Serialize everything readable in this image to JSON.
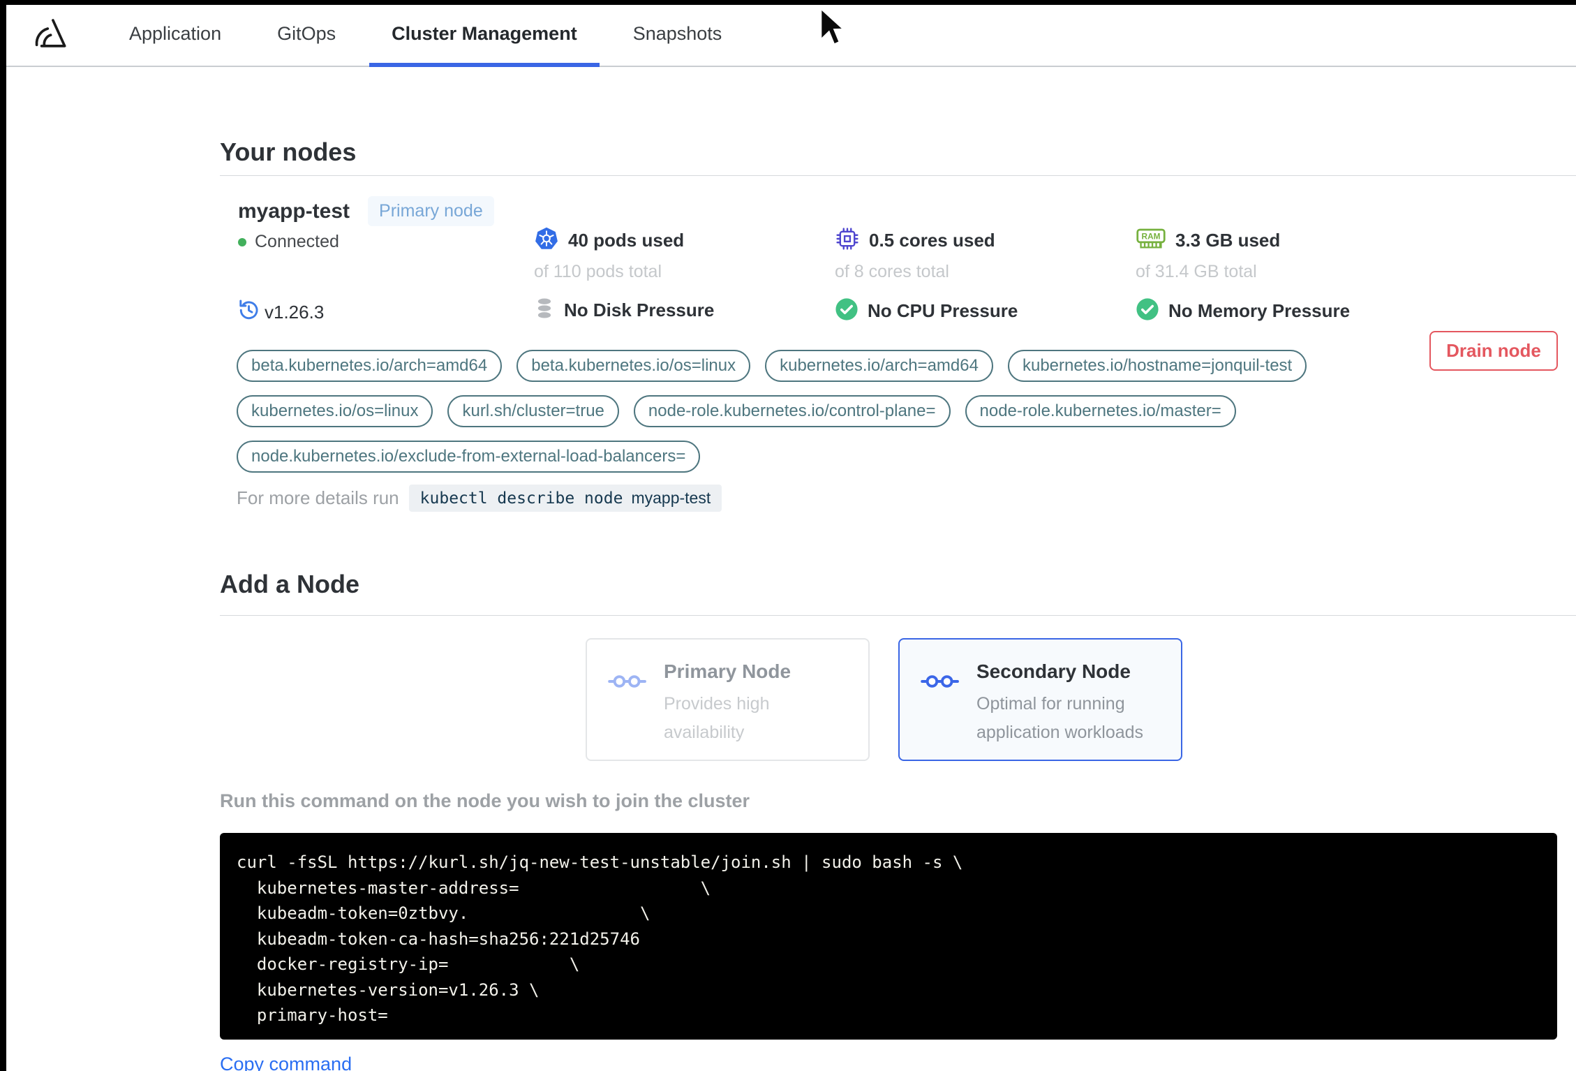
{
  "nav": {
    "tabs": [
      {
        "label": "Application",
        "active": false
      },
      {
        "label": "GitOps",
        "active": false
      },
      {
        "label": "Cluster Management",
        "active": true
      },
      {
        "label": "Snapshots",
        "active": false
      }
    ]
  },
  "your_nodes": {
    "title": "Your nodes",
    "node": {
      "name": "myapp-test",
      "badge": "Primary node",
      "status": "Connected",
      "version": "v1.26.3",
      "stats": [
        {
          "icon": "kubernetes-icon",
          "used": "40 pods used",
          "total": "of 110 pods total"
        },
        {
          "icon": "cpu-icon",
          "used": "0.5 cores used",
          "total": "of 8 cores total"
        },
        {
          "icon": "ram-icon",
          "used": "3.3 GB used",
          "total": "of 31.4 GB total"
        }
      ],
      "conditions": [
        {
          "icon": "disk-icon",
          "label": "No Disk Pressure"
        },
        {
          "icon": "check-circle-icon",
          "label": "No CPU Pressure"
        },
        {
          "icon": "check-circle-icon",
          "label": "No Memory Pressure"
        }
      ],
      "labels": [
        "beta.kubernetes.io/arch=amd64",
        "beta.kubernetes.io/os=linux",
        "kubernetes.io/arch=amd64",
        "kubernetes.io/hostname=jonquil-test",
        "kubernetes.io/os=linux",
        "kurl.sh/cluster=true",
        "node-role.kubernetes.io/control-plane=",
        "node-role.kubernetes.io/master=",
        "node.kubernetes.io/exclude-from-external-load-balancers="
      ],
      "details": {
        "prefix": "For more details run",
        "code": "kubectl describe node",
        "node_name": "myapp-test"
      },
      "drain_label": "Drain node"
    }
  },
  "add_node": {
    "title": "Add a Node",
    "options": [
      {
        "title": "Primary Node",
        "description": "Provides high availability",
        "selected": false
      },
      {
        "title": "Secondary Node",
        "description": "Optimal for running application workloads",
        "selected": true
      }
    ],
    "instruction": "Run this command on the node you wish to join the cluster",
    "command": "curl -fsSL https://kurl.sh/jq-new-test-unstable/join.sh | sudo bash -s \\\n  kubernetes-master-address=                  \\\n  kubeadm-token=0ztbvy.                 \\\n  kubeadm-token-ca-hash=sha256:221d25746\n  docker-registry-ip=            \\\n  kubernetes-version=v1.26.3 \\\n  primary-host=",
    "copy_label": "Copy command"
  },
  "colors": {
    "accent_blue": "#3a66e5",
    "badge_blue": "#78a7d7",
    "pill_slate": "#4e767f",
    "drain_red": "#e4575f",
    "connected_green": "#42b05c",
    "link_blue": "#2a6ef2",
    "kubernetes_blue": "#326de6",
    "cpu_indigo": "#4f46cf",
    "ram_green": "#76b13e",
    "terminal_bg": "#000000"
  }
}
